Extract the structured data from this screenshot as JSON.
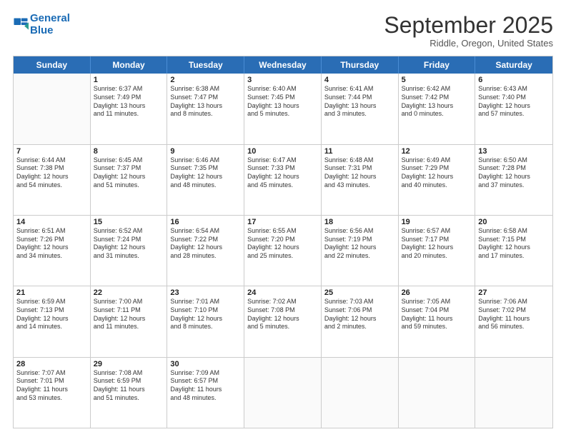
{
  "logo": {
    "line1": "General",
    "line2": "Blue"
  },
  "header": {
    "month": "September 2025",
    "location": "Riddle, Oregon, United States"
  },
  "days": [
    "Sunday",
    "Monday",
    "Tuesday",
    "Wednesday",
    "Thursday",
    "Friday",
    "Saturday"
  ],
  "rows": [
    [
      {
        "num": "",
        "lines": []
      },
      {
        "num": "1",
        "lines": [
          "Sunrise: 6:37 AM",
          "Sunset: 7:49 PM",
          "Daylight: 13 hours",
          "and 11 minutes."
        ]
      },
      {
        "num": "2",
        "lines": [
          "Sunrise: 6:38 AM",
          "Sunset: 7:47 PM",
          "Daylight: 13 hours",
          "and 8 minutes."
        ]
      },
      {
        "num": "3",
        "lines": [
          "Sunrise: 6:40 AM",
          "Sunset: 7:45 PM",
          "Daylight: 13 hours",
          "and 5 minutes."
        ]
      },
      {
        "num": "4",
        "lines": [
          "Sunrise: 6:41 AM",
          "Sunset: 7:44 PM",
          "Daylight: 13 hours",
          "and 3 minutes."
        ]
      },
      {
        "num": "5",
        "lines": [
          "Sunrise: 6:42 AM",
          "Sunset: 7:42 PM",
          "Daylight: 13 hours",
          "and 0 minutes."
        ]
      },
      {
        "num": "6",
        "lines": [
          "Sunrise: 6:43 AM",
          "Sunset: 7:40 PM",
          "Daylight: 12 hours",
          "and 57 minutes."
        ]
      }
    ],
    [
      {
        "num": "7",
        "lines": [
          "Sunrise: 6:44 AM",
          "Sunset: 7:38 PM",
          "Daylight: 12 hours",
          "and 54 minutes."
        ]
      },
      {
        "num": "8",
        "lines": [
          "Sunrise: 6:45 AM",
          "Sunset: 7:37 PM",
          "Daylight: 12 hours",
          "and 51 minutes."
        ]
      },
      {
        "num": "9",
        "lines": [
          "Sunrise: 6:46 AM",
          "Sunset: 7:35 PM",
          "Daylight: 12 hours",
          "and 48 minutes."
        ]
      },
      {
        "num": "10",
        "lines": [
          "Sunrise: 6:47 AM",
          "Sunset: 7:33 PM",
          "Daylight: 12 hours",
          "and 45 minutes."
        ]
      },
      {
        "num": "11",
        "lines": [
          "Sunrise: 6:48 AM",
          "Sunset: 7:31 PM",
          "Daylight: 12 hours",
          "and 43 minutes."
        ]
      },
      {
        "num": "12",
        "lines": [
          "Sunrise: 6:49 AM",
          "Sunset: 7:29 PM",
          "Daylight: 12 hours",
          "and 40 minutes."
        ]
      },
      {
        "num": "13",
        "lines": [
          "Sunrise: 6:50 AM",
          "Sunset: 7:28 PM",
          "Daylight: 12 hours",
          "and 37 minutes."
        ]
      }
    ],
    [
      {
        "num": "14",
        "lines": [
          "Sunrise: 6:51 AM",
          "Sunset: 7:26 PM",
          "Daylight: 12 hours",
          "and 34 minutes."
        ]
      },
      {
        "num": "15",
        "lines": [
          "Sunrise: 6:52 AM",
          "Sunset: 7:24 PM",
          "Daylight: 12 hours",
          "and 31 minutes."
        ]
      },
      {
        "num": "16",
        "lines": [
          "Sunrise: 6:54 AM",
          "Sunset: 7:22 PM",
          "Daylight: 12 hours",
          "and 28 minutes."
        ]
      },
      {
        "num": "17",
        "lines": [
          "Sunrise: 6:55 AM",
          "Sunset: 7:20 PM",
          "Daylight: 12 hours",
          "and 25 minutes."
        ]
      },
      {
        "num": "18",
        "lines": [
          "Sunrise: 6:56 AM",
          "Sunset: 7:19 PM",
          "Daylight: 12 hours",
          "and 22 minutes."
        ]
      },
      {
        "num": "19",
        "lines": [
          "Sunrise: 6:57 AM",
          "Sunset: 7:17 PM",
          "Daylight: 12 hours",
          "and 20 minutes."
        ]
      },
      {
        "num": "20",
        "lines": [
          "Sunrise: 6:58 AM",
          "Sunset: 7:15 PM",
          "Daylight: 12 hours",
          "and 17 minutes."
        ]
      }
    ],
    [
      {
        "num": "21",
        "lines": [
          "Sunrise: 6:59 AM",
          "Sunset: 7:13 PM",
          "Daylight: 12 hours",
          "and 14 minutes."
        ]
      },
      {
        "num": "22",
        "lines": [
          "Sunrise: 7:00 AM",
          "Sunset: 7:11 PM",
          "Daylight: 12 hours",
          "and 11 minutes."
        ]
      },
      {
        "num": "23",
        "lines": [
          "Sunrise: 7:01 AM",
          "Sunset: 7:10 PM",
          "Daylight: 12 hours",
          "and 8 minutes."
        ]
      },
      {
        "num": "24",
        "lines": [
          "Sunrise: 7:02 AM",
          "Sunset: 7:08 PM",
          "Daylight: 12 hours",
          "and 5 minutes."
        ]
      },
      {
        "num": "25",
        "lines": [
          "Sunrise: 7:03 AM",
          "Sunset: 7:06 PM",
          "Daylight: 12 hours",
          "and 2 minutes."
        ]
      },
      {
        "num": "26",
        "lines": [
          "Sunrise: 7:05 AM",
          "Sunset: 7:04 PM",
          "Daylight: 11 hours",
          "and 59 minutes."
        ]
      },
      {
        "num": "27",
        "lines": [
          "Sunrise: 7:06 AM",
          "Sunset: 7:02 PM",
          "Daylight: 11 hours",
          "and 56 minutes."
        ]
      }
    ],
    [
      {
        "num": "28",
        "lines": [
          "Sunrise: 7:07 AM",
          "Sunset: 7:01 PM",
          "Daylight: 11 hours",
          "and 53 minutes."
        ]
      },
      {
        "num": "29",
        "lines": [
          "Sunrise: 7:08 AM",
          "Sunset: 6:59 PM",
          "Daylight: 11 hours",
          "and 51 minutes."
        ]
      },
      {
        "num": "30",
        "lines": [
          "Sunrise: 7:09 AM",
          "Sunset: 6:57 PM",
          "Daylight: 11 hours",
          "and 48 minutes."
        ]
      },
      {
        "num": "",
        "lines": []
      },
      {
        "num": "",
        "lines": []
      },
      {
        "num": "",
        "lines": []
      },
      {
        "num": "",
        "lines": []
      }
    ]
  ]
}
